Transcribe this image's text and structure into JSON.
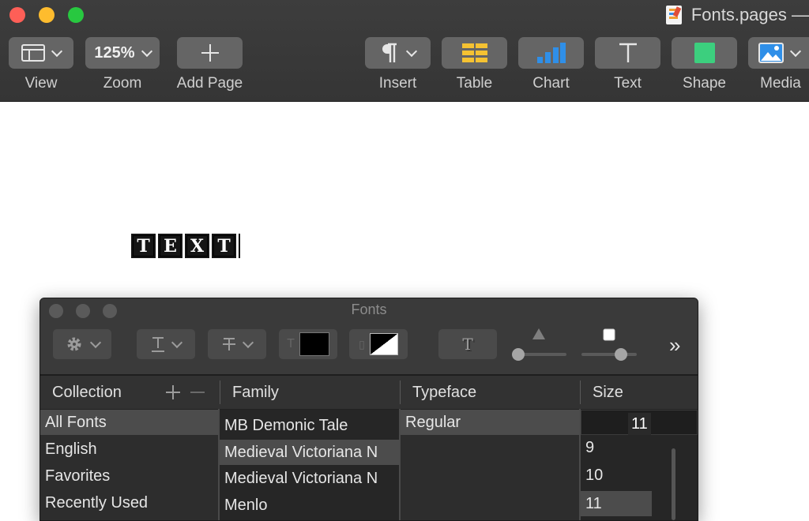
{
  "window": {
    "document_title": "Fonts.pages —"
  },
  "toolbar": {
    "view_label": "View",
    "zoom_value": "125%",
    "zoom_label": "Zoom",
    "add_page_label": "Add Page",
    "insert_label": "Insert",
    "table_label": "Table",
    "chart_label": "Chart",
    "text_label": "Text",
    "shape_label": "Shape",
    "media_label": "Media"
  },
  "document": {
    "sample_glyphs": [
      "T",
      "E",
      "X",
      "T"
    ]
  },
  "fonts_panel": {
    "title": "Fonts",
    "more_label": "»",
    "headers": {
      "collection": "Collection",
      "family": "Family",
      "typeface": "Typeface",
      "size": "Size"
    },
    "collections": [
      "All Fonts",
      "English",
      "Favorites",
      "Recently Used"
    ],
    "families": [
      "MB Demonic Tale",
      "Medieval Victoriana N",
      "Medieval Victoriana N",
      "Menlo"
    ],
    "typefaces": [
      "Regular"
    ],
    "size_value": "11",
    "sizes": [
      "9",
      "10",
      "11"
    ]
  },
  "colors": {
    "accent_yellow": "#f5c232",
    "accent_blue": "#2f8fe8",
    "shape_green": "#3ccf7e",
    "close_red": "#fe5f57"
  }
}
